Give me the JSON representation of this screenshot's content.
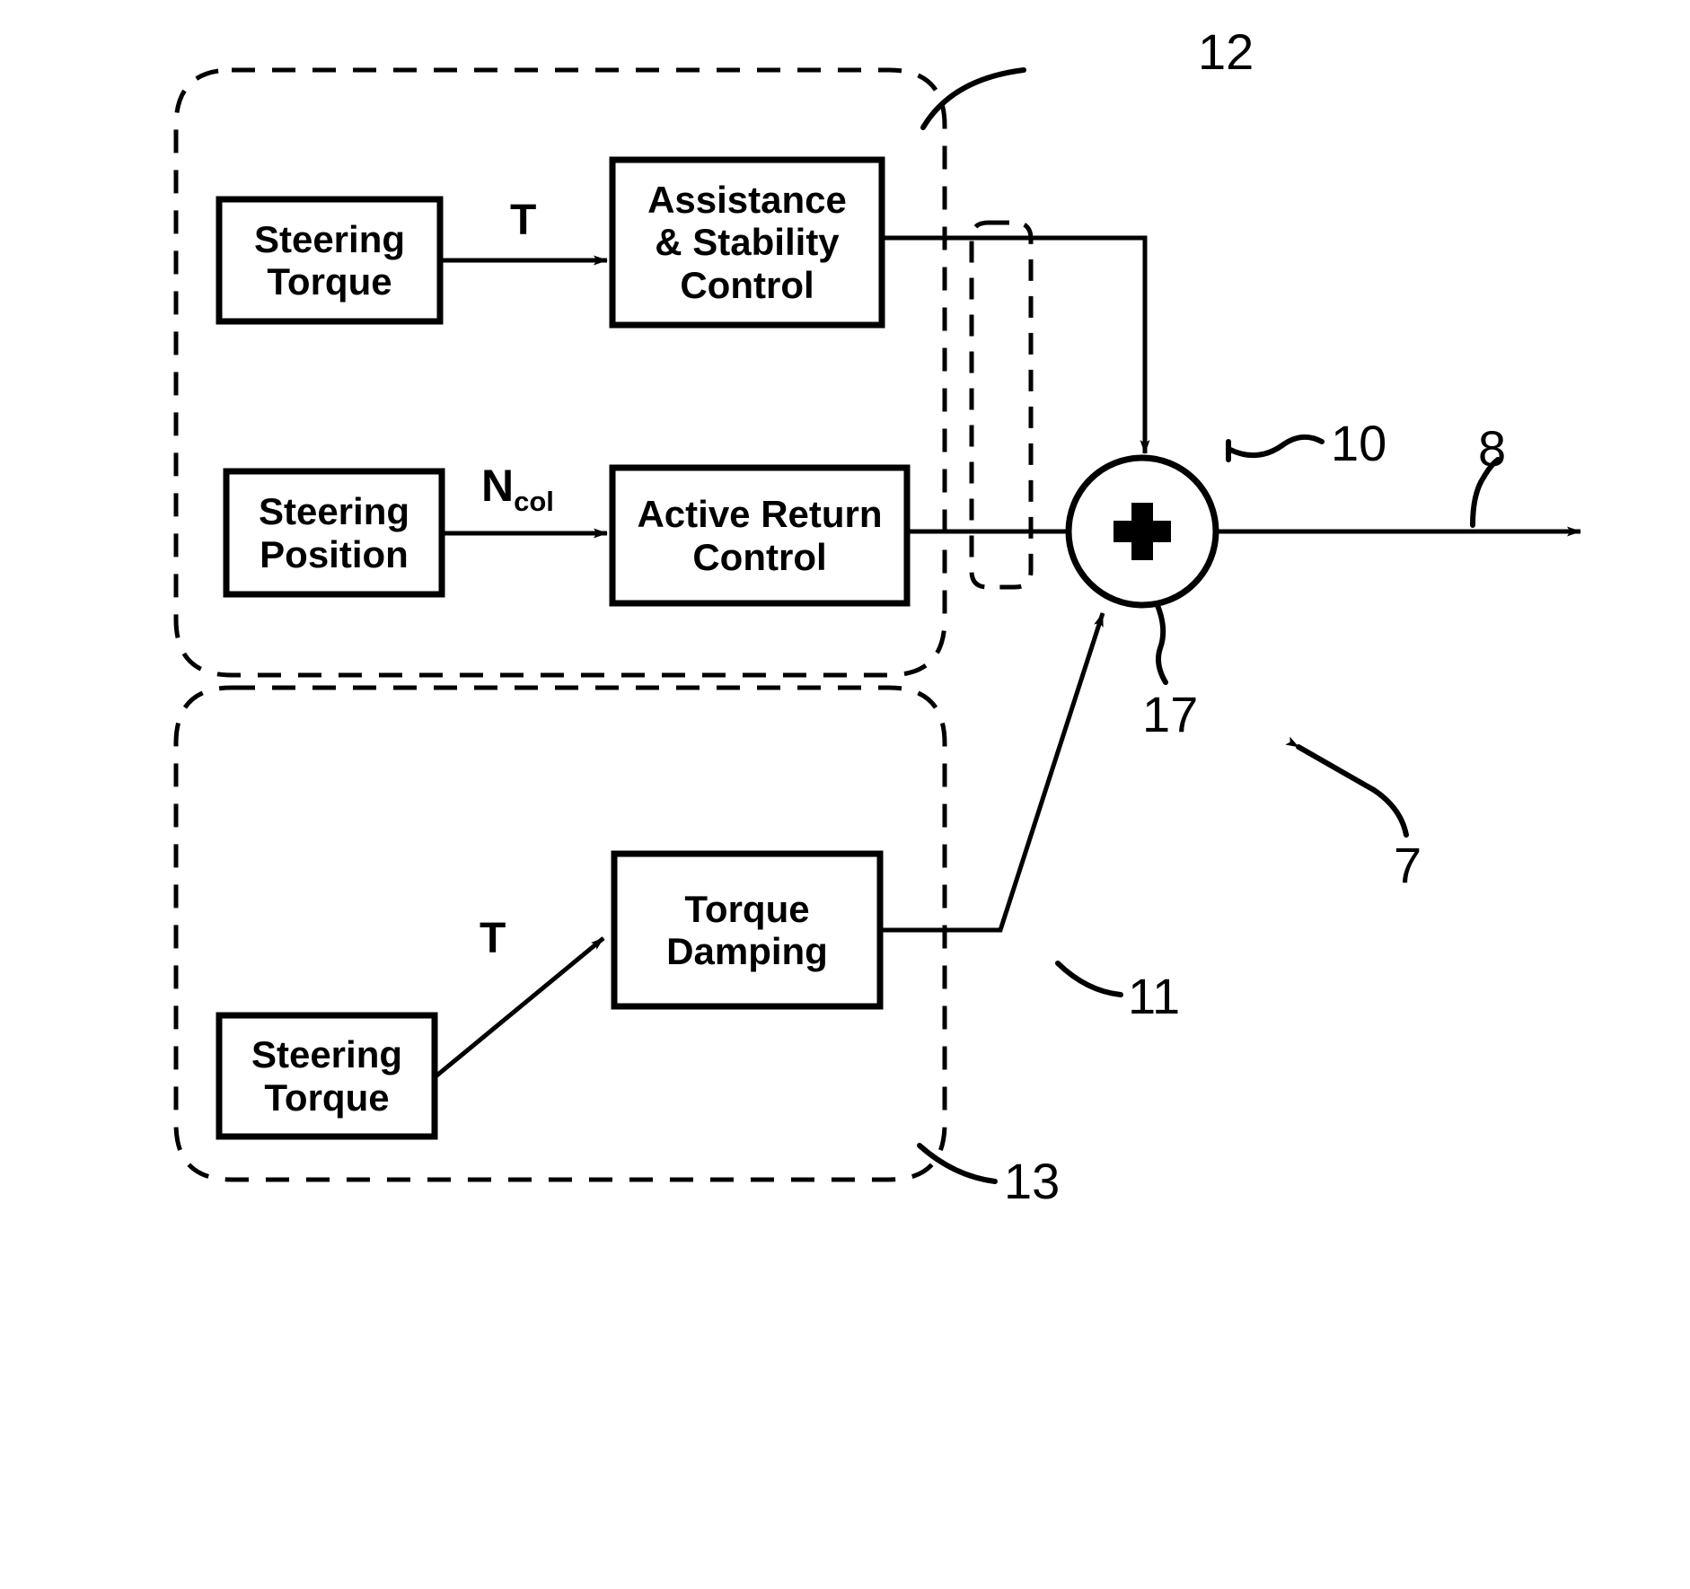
{
  "figure": {
    "type": "block-diagram",
    "title": "Steering control block diagram",
    "background_color": "#ffffff",
    "line_color": "#000000"
  },
  "blocks": [
    {
      "id": "steering_torque_top",
      "label": "Steering\nTorque"
    },
    {
      "id": "assistance_stability",
      "label": "Assistance\n& Stability\nControl"
    },
    {
      "id": "steering_position",
      "label": "Steering\nPosition"
    },
    {
      "id": "active_return",
      "label": "Active Return\nControl"
    },
    {
      "id": "torque_damping",
      "label": "Torque\nDamping"
    },
    {
      "id": "steering_torque_bottom",
      "label": "Steering\nTorque"
    }
  ],
  "signal_labels": {
    "torque_top": "T",
    "steering_position_signal_main": "N",
    "steering_position_signal_sub": "col",
    "torque_bottom": "T"
  },
  "summing_junction": {
    "operator": "+"
  },
  "reference_numerals": [
    {
      "id": "ref-12",
      "value": "12"
    },
    {
      "id": "ref-10",
      "value": "10"
    },
    {
      "id": "ref-8",
      "value": "8"
    },
    {
      "id": "ref-17",
      "value": "17"
    },
    {
      "id": "ref-7",
      "value": "7"
    },
    {
      "id": "ref-11",
      "value": "11"
    },
    {
      "id": "ref-13",
      "value": "13"
    }
  ]
}
